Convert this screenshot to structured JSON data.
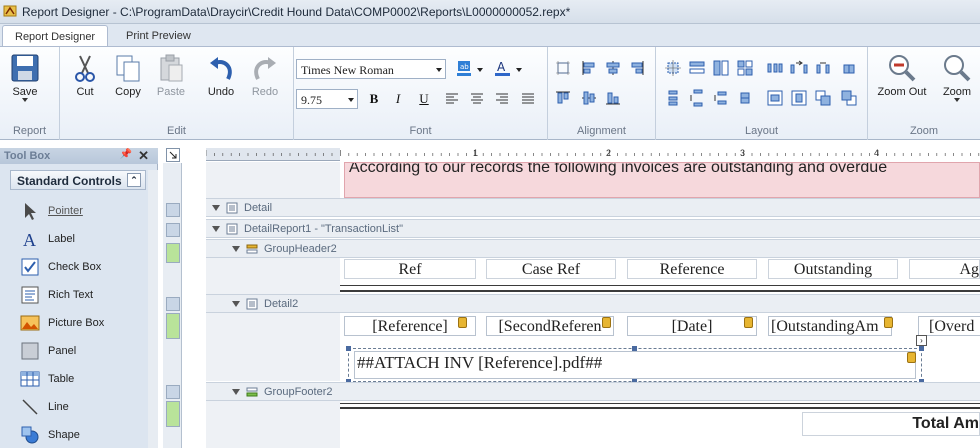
{
  "window": {
    "title": "Report Designer - C:\\ProgramData\\Draycir\\Credit Hound Data\\COMP0002\\Reports\\L0000000052.repx*"
  },
  "tabs": [
    {
      "label": "Report Designer",
      "active": true
    },
    {
      "label": "Print Preview",
      "active": false
    }
  ],
  "ribbon": {
    "report": {
      "label": "Report",
      "save": "Save"
    },
    "edit": {
      "label": "Edit",
      "cut": "Cut",
      "copy": "Copy",
      "paste": "Paste",
      "undo": "Undo",
      "redo": "Redo"
    },
    "font": {
      "label": "Font",
      "family": "Times New Roman",
      "size": "9.75",
      "bold": "B",
      "italic": "I",
      "underline": "U"
    },
    "alignment": {
      "label": "Alignment"
    },
    "layout": {
      "label": "Layout"
    },
    "zoom": {
      "label": "Zoom",
      "zoom_out": "Zoom Out",
      "zoom": "Zoom"
    }
  },
  "toolbox": {
    "title": "Tool Box",
    "group": "Standard Controls",
    "items": [
      {
        "label": "Pointer",
        "icon": "pointer-icon"
      },
      {
        "label": "Label",
        "icon": "label-icon"
      },
      {
        "label": "Check Box",
        "icon": "checkbox-icon"
      },
      {
        "label": "Rich Text",
        "icon": "rich-text-icon"
      },
      {
        "label": "Picture Box",
        "icon": "picture-box-icon"
      },
      {
        "label": "Panel",
        "icon": "panel-icon"
      },
      {
        "label": "Table",
        "icon": "table-icon"
      },
      {
        "label": "Line",
        "icon": "line-icon"
      },
      {
        "label": "Shape",
        "icon": "shape-icon"
      }
    ]
  },
  "ruler": {
    "numbers": [
      "1",
      "2",
      "3",
      "4"
    ]
  },
  "report": {
    "banner": "According to our records the following invoices are outstanding and overdue",
    "bands": {
      "detail": "Detail",
      "detail_report": "DetailReport1 - \"TransactionList\"",
      "group_header": "GroupHeader2",
      "detail2": "Detail2",
      "group_footer": "GroupFooter2"
    },
    "header_cells": [
      "Ref",
      "Case Ref",
      "Reference",
      "Outstanding",
      "Ag"
    ],
    "field_cells": [
      "[Reference]",
      "[SecondReferen",
      "[Date]",
      "[OutstandingAm",
      "[Overd"
    ],
    "attach": "##ATTACH INV [Reference].pdf##",
    "footer_total": "Total Am"
  }
}
